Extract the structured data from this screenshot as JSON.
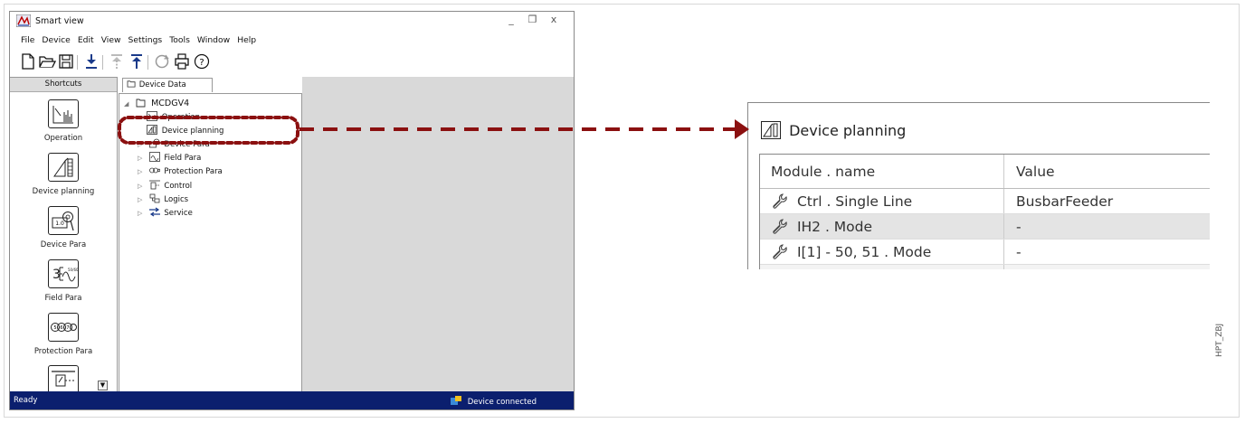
{
  "app": {
    "title": "Smart view",
    "menu": [
      "File",
      "Device",
      "Edit",
      "View",
      "Settings",
      "Tools",
      "Window",
      "Help"
    ],
    "window_controls": [
      "_",
      "❐",
      "x"
    ]
  },
  "toolbar": {
    "icons": [
      "new-file-icon",
      "open-folder-icon",
      "save-icon",
      "download-icon",
      "upload-disabled-icon",
      "upload-icon",
      "refresh-icon",
      "print-icon",
      "help-icon"
    ],
    "help_glyph": "?"
  },
  "shortcuts": {
    "header": "Shortcuts",
    "items": [
      {
        "label": "Operation",
        "icon": "operation-icon"
      },
      {
        "label": "Device planning",
        "icon": "device-planning-icon"
      },
      {
        "label": "Device Para",
        "icon": "device-para-icon"
      },
      {
        "label": "Field Para",
        "icon": "field-para-icon"
      },
      {
        "label": "Protection Para",
        "icon": "protection-para-icon"
      },
      {
        "label": "",
        "icon": "control-icon"
      }
    ],
    "scroll_glyph": "▼"
  },
  "tree": {
    "tab": "Device Data",
    "root": "MCDGV4",
    "items": [
      {
        "label": "Operation",
        "icon": "operation-icon"
      },
      {
        "label": "Device planning",
        "icon": "device-planning-icon"
      },
      {
        "label": "Device Para",
        "icon": "device-para-icon"
      },
      {
        "label": "Field Para",
        "icon": "field-para-icon"
      },
      {
        "label": "Protection Para",
        "icon": "protection-para-icon"
      },
      {
        "label": "Control",
        "icon": "control-icon"
      },
      {
        "label": "Logics",
        "icon": "logics-icon"
      },
      {
        "label": "Service",
        "icon": "service-icon"
      }
    ]
  },
  "status": {
    "left": "Ready",
    "right": "Device connected"
  },
  "detail": {
    "title": "Device planning",
    "columns": [
      "Module . name",
      "Value"
    ],
    "rows": [
      {
        "name": "Ctrl . Single Line",
        "value": "BusbarFeeder"
      },
      {
        "name": "IH2 . Mode",
        "value": "-"
      },
      {
        "name": "I[1] - 50, 51 . Mode",
        "value": "-"
      }
    ]
  },
  "colors": {
    "highlight": "#8b1010",
    "statusbar": "#0b1f6e",
    "panel_grey": "#d9d9d9"
  },
  "doc_code": "HPT_ZBJ"
}
